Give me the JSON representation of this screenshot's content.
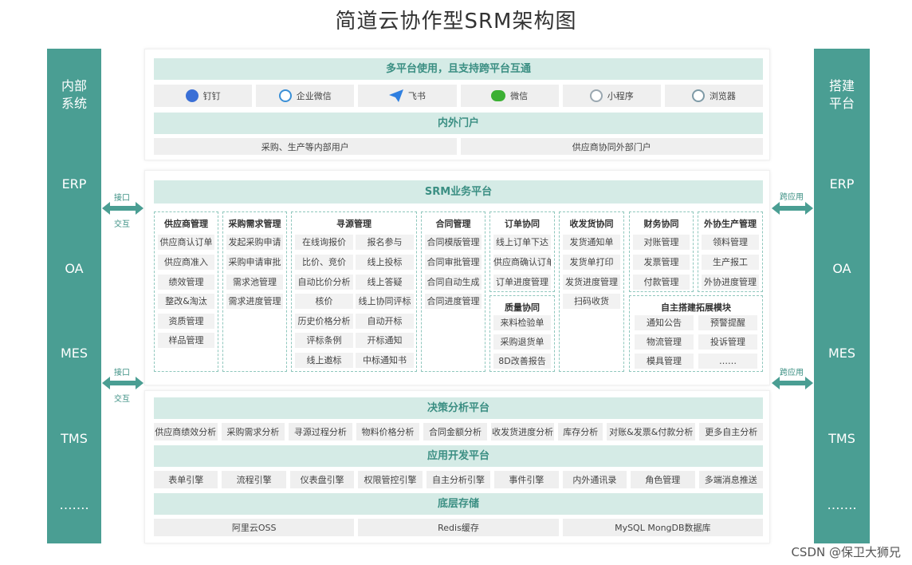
{
  "title": "简道云协作型SRM架构图",
  "watermark": "CSDN @保卫大狮兄",
  "colors": {
    "accent": "#4a9e93",
    "band": "#d5ebe6",
    "chip": "#efefef"
  },
  "left_column": {
    "head": "内部\n系统",
    "items": [
      "ERP",
      "OA",
      "MES",
      "TMS",
      "……."
    ]
  },
  "right_column": {
    "head": "搭建\n平台",
    "items": [
      "ERP",
      "OA",
      "MES",
      "TMS",
      "……."
    ]
  },
  "connectors": {
    "left_top": [
      "接口",
      "交互"
    ],
    "left_bottom": [
      "接口",
      "交互"
    ],
    "right_top": "跨应用",
    "right_bottom": "跨应用"
  },
  "top": {
    "band1": "多平台使用，且支持跨平台互通",
    "platforms": [
      {
        "label": "钉钉",
        "icon": "dingtalk-icon",
        "color": "#3a6fd6"
      },
      {
        "label": "企业微信",
        "icon": "wecom-icon",
        "color": "#3a8fd6"
      },
      {
        "label": "飞书",
        "icon": "feishu-icon",
        "color": "#2f7fe0"
      },
      {
        "label": "微信",
        "icon": "wechat-icon",
        "color": "#3cb034"
      },
      {
        "label": "小程序",
        "icon": "miniprogram-icon",
        "color": "#9aa7b0"
      },
      {
        "label": "浏览器",
        "icon": "browser-icon",
        "color": "#7e9aa6"
      }
    ],
    "band2": "内外门户",
    "portals": [
      "采购、生产等内部用户",
      "供应商协同外部门户"
    ]
  },
  "srm": {
    "band": "SRM业务平台",
    "modules": {
      "supplier": {
        "title": "供应商管理",
        "items": [
          "供应商认订单",
          "供应商准入",
          "绩效管理",
          "整改&淘汰",
          "资质管理",
          "样品管理"
        ]
      },
      "demand": {
        "title": "采购需求管理",
        "items": [
          "发起采购申请",
          "采购申请审批",
          "需求池管理",
          "需求进度管理"
        ]
      },
      "sourcing": {
        "title": "寻源管理",
        "left": [
          "在线询报价",
          "比价、竞价",
          "自动比价分析",
          "核价",
          "历史价格分析",
          "评标条例",
          "线上邀标"
        ],
        "right": [
          "报名参与",
          "线上投标",
          "线上答疑",
          "线上协同评标",
          "自动开标",
          "开标通知",
          "中标通知书"
        ]
      },
      "contract": {
        "title": "合同管理",
        "items": [
          "合同模版管理",
          "合同审批管理",
          "合同自动生成",
          "合同进度管理"
        ]
      },
      "order": {
        "title": "订单协同",
        "items": [
          "线上订单下达",
          "供应商确认订单",
          "订单进度管理"
        ]
      },
      "quality": {
        "title": "质量协同",
        "items": [
          "来料检验单",
          "采购退货单",
          "8D改善报告"
        ]
      },
      "delivery": {
        "title": "收发货协同",
        "items": [
          "发货通知单",
          "发货单打印",
          "发货进度管理",
          "扫码收货"
        ]
      },
      "finance": {
        "title": "财务协同",
        "items": [
          "对账管理",
          "发票管理",
          "付款管理"
        ]
      },
      "outsourcing": {
        "title": "外协生产管理",
        "items": [
          "领料管理",
          "生产报工",
          "外协进度管理"
        ]
      },
      "custom": {
        "title": "自主搭建拓展模块",
        "left": [
          "通知公告",
          "物流管理",
          "模具管理"
        ],
        "right": [
          "预警提醒",
          "投诉管理",
          "……"
        ]
      }
    }
  },
  "bottom": {
    "band1": "决策分析平台",
    "analysis": [
      "供应商绩效分析",
      "采购需求分析",
      "寻源过程分析",
      "物料价格分析",
      "合同金额分析",
      "收发货进度分析",
      "库存分析",
      "对账&发票&付款分析",
      "更多自主分析"
    ],
    "band2": "应用开发平台",
    "devtools": [
      "表单引擎",
      "流程引擎",
      "仪表盘引擎",
      "权限管控引擎",
      "自主分析引擎",
      "事件引擎",
      "内外通讯录",
      "角色管理",
      "多端消息推送"
    ],
    "band3": "底层存储",
    "storage": [
      "阿里云OSS",
      "Redis缓存",
      "MySQL MongDB数据库"
    ]
  }
}
